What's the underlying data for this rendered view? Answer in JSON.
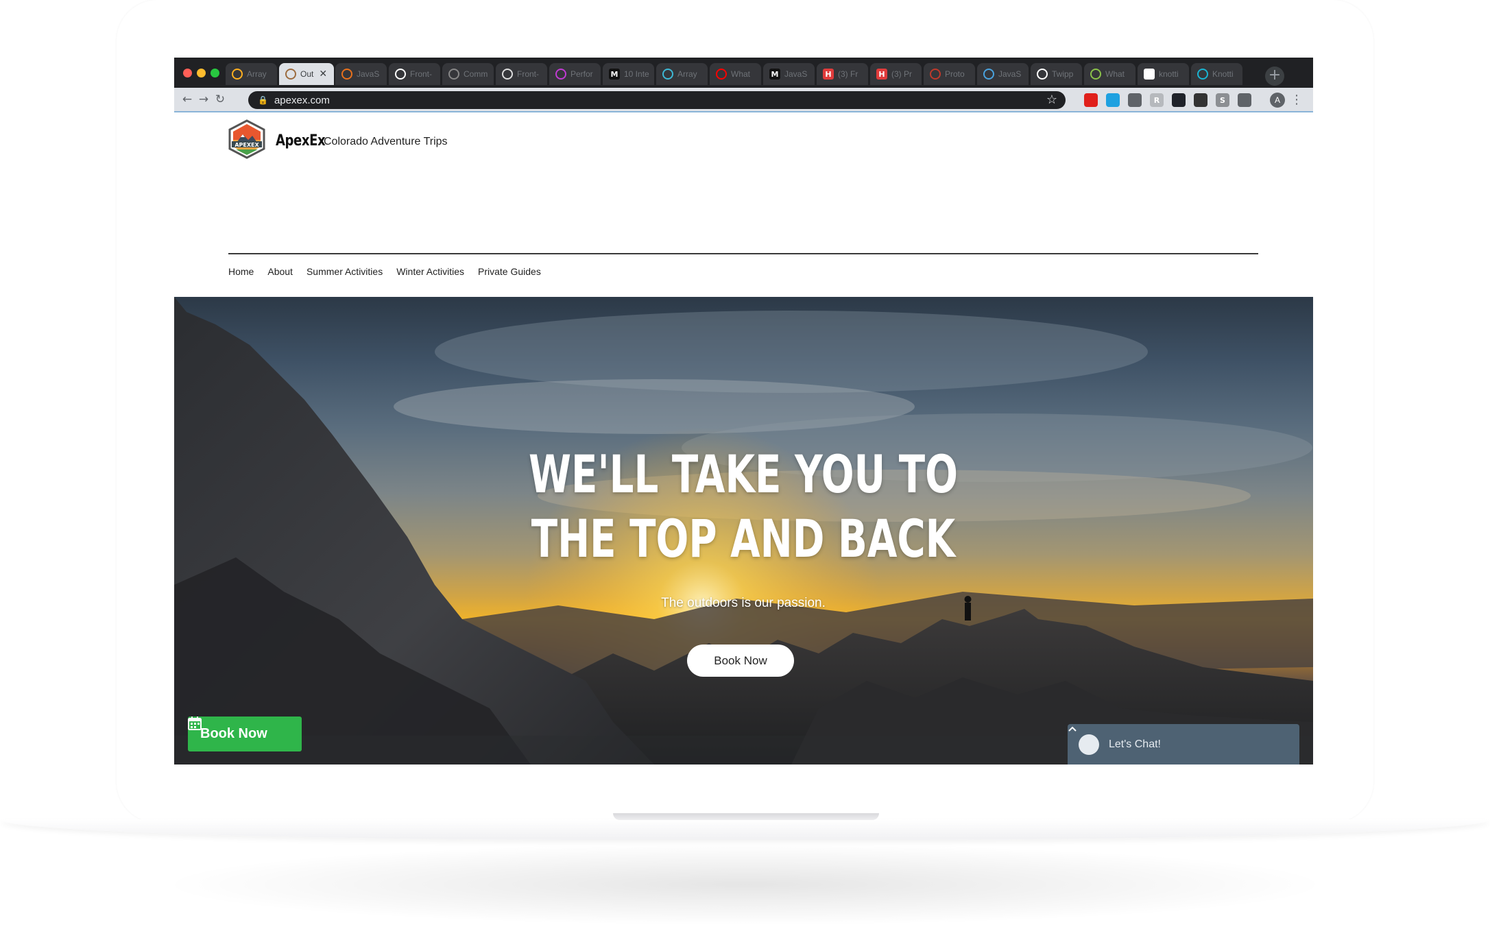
{
  "browser": {
    "tabs": [
      {
        "label": "Array",
        "favicon": "jira-icon",
        "color": "#ffb020"
      },
      {
        "label": "Out",
        "favicon": "apex-icon",
        "color": "#9c6b3e",
        "active": true
      },
      {
        "label": "JavaS",
        "favicon": "fire-icon",
        "color": "#e9711c"
      },
      {
        "label": "Front-",
        "favicon": "github-icon",
        "color": "#ffffff"
      },
      {
        "label": "Comm",
        "favicon": "stripe-icon",
        "color": "#888888"
      },
      {
        "label": "Front-",
        "favicon": "book-icon",
        "color": "#dddddd"
      },
      {
        "label": "Perfor",
        "favicon": "star-icon",
        "color": "#c23bd4"
      },
      {
        "label": "10 Inte",
        "favicon": "medium-icon",
        "color": "#111111",
        "glyph": "M"
      },
      {
        "label": "Array",
        "favicon": "codepen-icon",
        "color": "#3db9d6"
      },
      {
        "label": "What",
        "favicon": "youtube-icon",
        "color": "#ff0000"
      },
      {
        "label": "JavaS",
        "favicon": "medium-icon",
        "color": "#111111",
        "glyph": "M"
      },
      {
        "label": "(3) Fr",
        "favicon": "hackernoon-icon",
        "color": "#e03b3b",
        "glyph": "H"
      },
      {
        "label": "(3) Pr",
        "favicon": "hackernoon-icon",
        "color": "#e03b3b",
        "glyph": "H"
      },
      {
        "label": "Proto",
        "favicon": "red-circle-icon",
        "color": "#c0392b"
      },
      {
        "label": "JavaS",
        "favicon": "globe-icon",
        "color": "#4aa3df"
      },
      {
        "label": "Twipp",
        "favicon": "github-icon",
        "color": "#ffffff"
      },
      {
        "label": "What",
        "favicon": "leaf-icon",
        "color": "#8bc34a"
      },
      {
        "label": "knotti",
        "favicon": "google-icon",
        "color": "#ffffff",
        "glyph": "G"
      },
      {
        "label": "Knotti",
        "favicon": "circle-icon",
        "color": "#19b5d3"
      }
    ],
    "close_glyph": "✕",
    "new_tab_glyph": "+",
    "back_glyph": "←",
    "forward_glyph": "→",
    "reload_glyph": "↻",
    "lock_glyph": "🔒",
    "url": "apexex.com",
    "star_glyph": "☆",
    "extensions": [
      {
        "name": "opera-icon",
        "color": "#e0201b"
      },
      {
        "name": "bird-icon",
        "color": "#1fa1e0"
      },
      {
        "name": "eyedropper-icon",
        "color": "#5f6368"
      },
      {
        "name": "r-ext-icon",
        "color": "#b6b9bd",
        "glyph": "R"
      },
      {
        "name": "react-ext-icon",
        "color": "#20232a"
      },
      {
        "name": "circle-ext-icon",
        "color": "#333333"
      },
      {
        "name": "s-ext-icon",
        "color": "#8c8f93",
        "glyph": "S"
      },
      {
        "name": "playlist-icon",
        "color": "#5f6368"
      }
    ],
    "avatar_letter": "A",
    "menu_glyph": "⋮"
  },
  "site": {
    "brand_name": "ApexEx",
    "tagline": "Colorado Adventure Trips",
    "logo_text": "APEXEX",
    "nav": [
      "Home",
      "About",
      "Summer Activities",
      "Winter Activities",
      "Private Guides"
    ]
  },
  "hero": {
    "title_line1": "WE'LL TAKE YOU TO",
    "title_line2": "THE TOP AND BACK",
    "subtitle": "The outdoors is our passion.",
    "cta": "Book Now"
  },
  "widgets": {
    "book_label": "Book Now",
    "chat_label": "Let's Chat!"
  }
}
